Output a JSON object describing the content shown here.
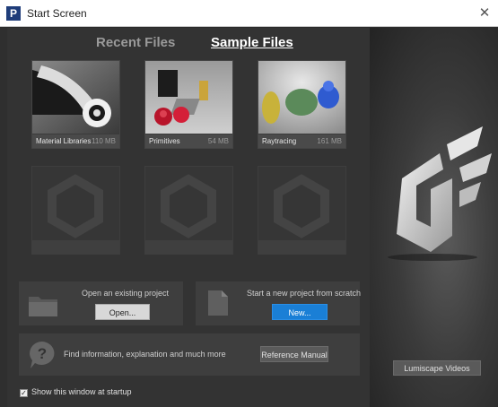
{
  "window": {
    "title": "Start Screen",
    "app_icon_letter": "P",
    "close_glyph": "✕"
  },
  "tabs": {
    "recent": "Recent Files",
    "sample": "Sample Files"
  },
  "cards": [
    {
      "name": "Material Libraries",
      "size": "110 MB"
    },
    {
      "name": "Primitives",
      "size": "54 MB"
    },
    {
      "name": "Raytracing",
      "size": "161 MB"
    }
  ],
  "open_panel": {
    "text": "Open an existing project",
    "button": "Open..."
  },
  "new_panel": {
    "text": "Start a new project from scratch",
    "button": "New..."
  },
  "help_panel": {
    "text": "Find information, explanation and much more",
    "button": "Reference Manual"
  },
  "side": {
    "videos_button": "Lumiscape Videos"
  },
  "footer": {
    "show_at_startup": "Show this window at startup",
    "checked": true
  },
  "colors": {
    "accent_blue": "#1a7fd6",
    "background": "#2f2f2f"
  }
}
